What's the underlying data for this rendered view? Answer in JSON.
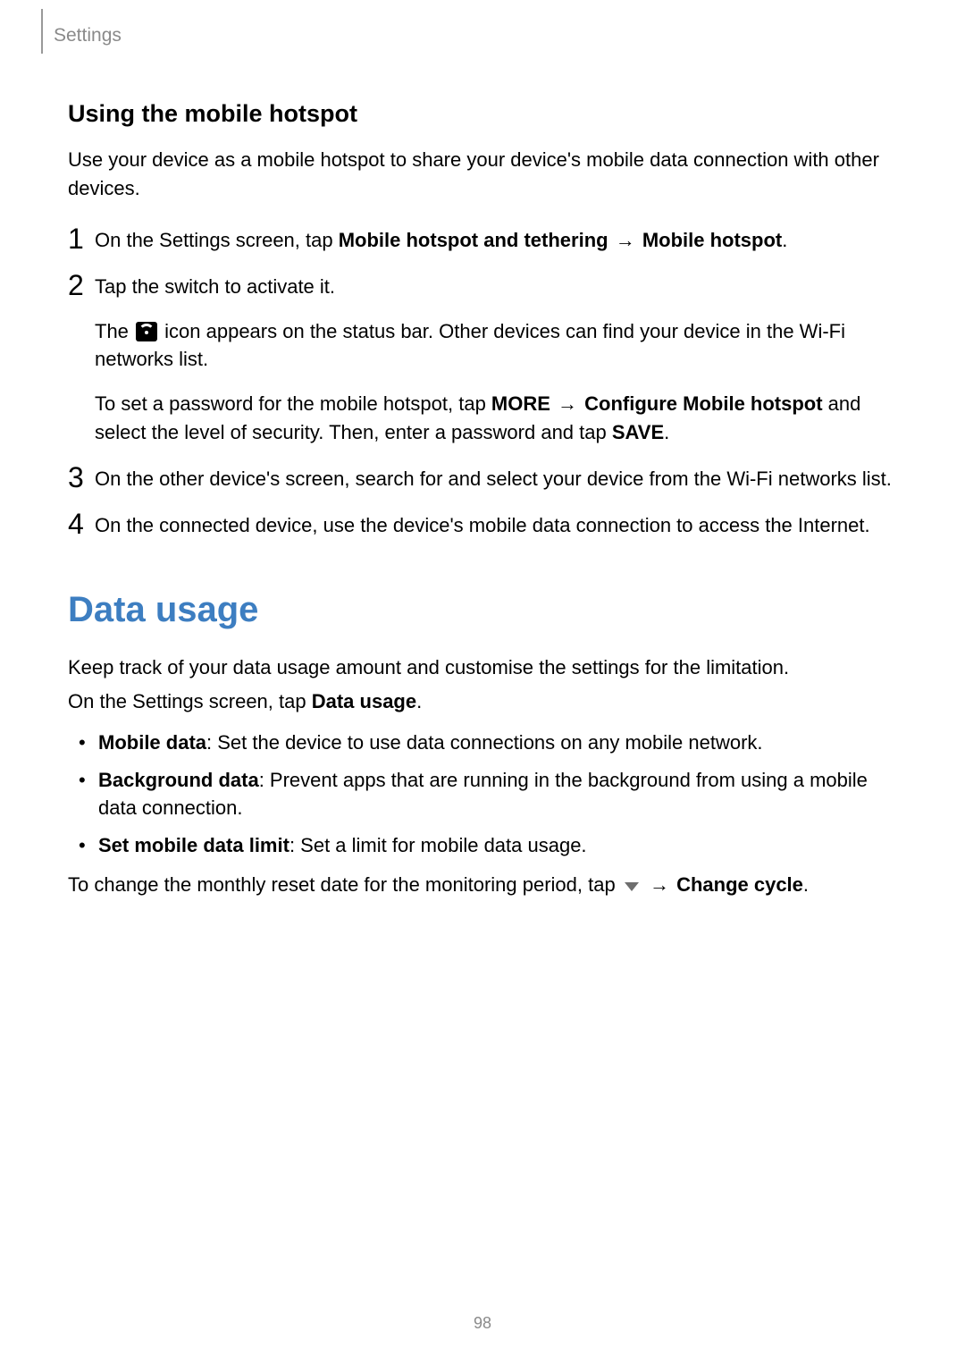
{
  "header": {
    "section": "Settings"
  },
  "section1": {
    "heading": "Using the mobile hotspot",
    "intro": "Use your device as a mobile hotspot to share your device's mobile data connection with other devices.",
    "steps": [
      {
        "num": "1",
        "p1_a": "On the Settings screen, tap ",
        "p1_b": "Mobile hotspot and tethering",
        "p1_arrow": " → ",
        "p1_c": "Mobile hotspot",
        "p1_d": "."
      },
      {
        "num": "2",
        "p1": "Tap the switch to activate it.",
        "p2_a": "The ",
        "p2_b": " icon appears on the status bar. Other devices can find your device in the Wi-Fi networks list.",
        "p3_a": "To set a password for the mobile hotspot, tap ",
        "p3_b": "MORE",
        "p3_arrow1": " → ",
        "p3_c": "Configure Mobile hotspot",
        "p3_d": " and select the level of security. Then, enter a password and tap ",
        "p3_e": "SAVE",
        "p3_f": "."
      },
      {
        "num": "3",
        "p1": "On the other device's screen, search for and select your device from the Wi-Fi networks list."
      },
      {
        "num": "4",
        "p1": "On the connected device, use the device's mobile data connection to access the Internet."
      }
    ]
  },
  "section2": {
    "heading": "Data usage",
    "intro": "Keep track of your data usage amount and customise the settings for the limitation.",
    "nav_a": "On the Settings screen, tap ",
    "nav_b": "Data usage",
    "nav_c": ".",
    "bullets": [
      {
        "bold": "Mobile data",
        "rest": ": Set the device to use data connections on any mobile network."
      },
      {
        "bold": "Background data",
        "rest": ": Prevent apps that are running in the background from using a mobile data connection."
      },
      {
        "bold": "Set mobile data limit",
        "rest": ": Set a limit for mobile data usage."
      }
    ],
    "tail_a": "To change the monthly reset date for the monitoring period, tap ",
    "tail_arrow": " → ",
    "tail_b": "Change cycle",
    "tail_c": "."
  },
  "pageNumber": "98"
}
